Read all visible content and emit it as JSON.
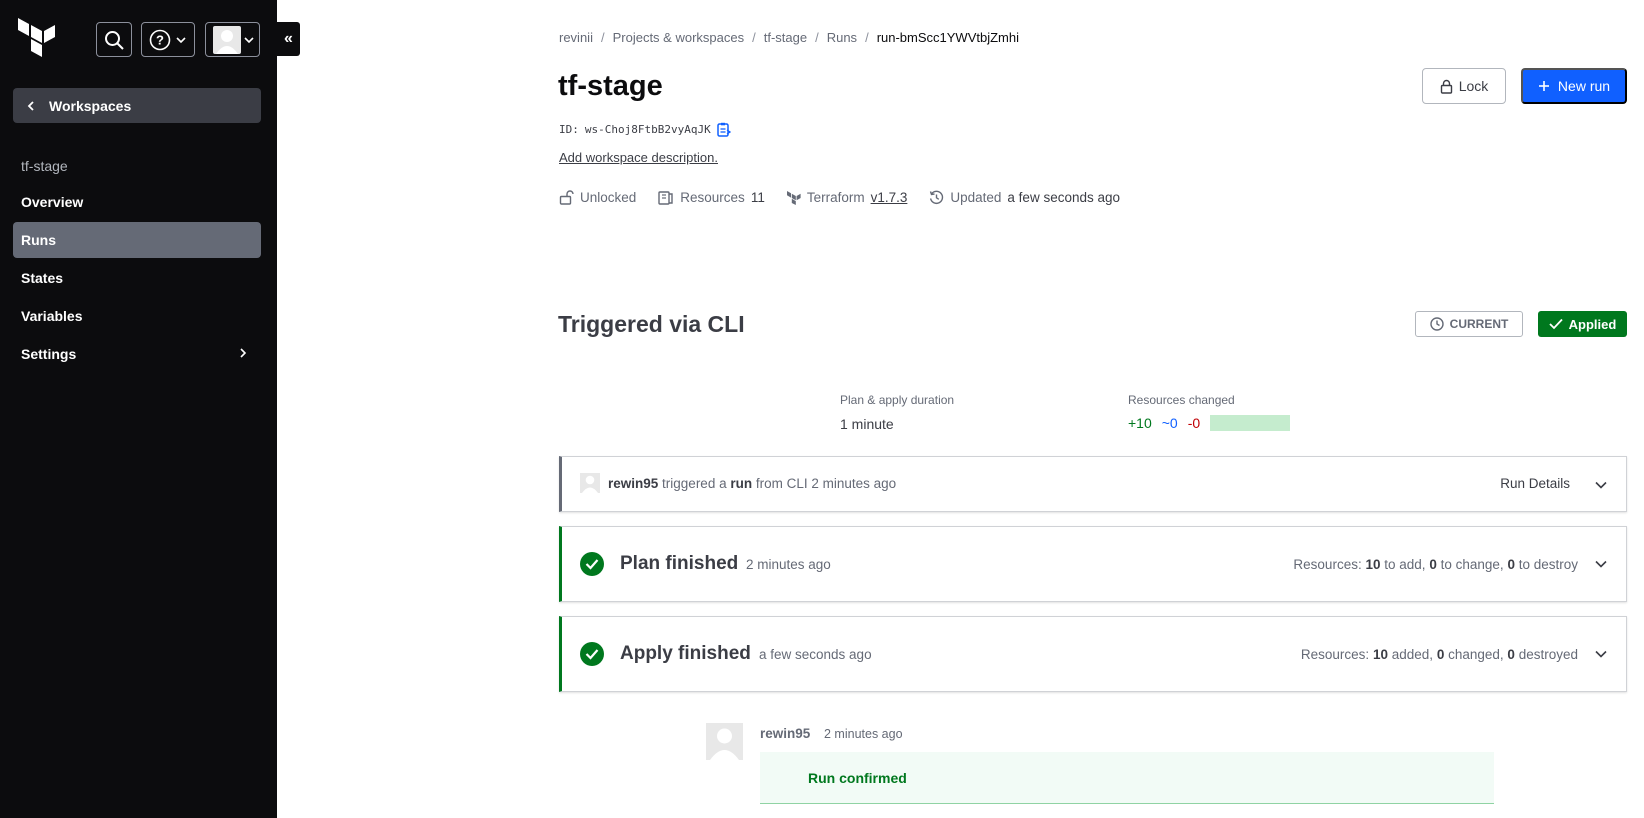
{
  "nav": {
    "workspaces_label": "Workspaces",
    "workspace_name": "tf-stage",
    "items": [
      {
        "label": "Overview"
      },
      {
        "label": "Runs"
      },
      {
        "label": "States"
      },
      {
        "label": "Variables"
      },
      {
        "label": "Settings"
      }
    ],
    "active": "Runs"
  },
  "breadcrumb": [
    "revinii",
    "Projects & workspaces",
    "tf-stage",
    "Runs",
    "run-bmScc1YWVtbjZmhi"
  ],
  "workspace": {
    "title": "tf-stage",
    "id_label": "ID:",
    "id": "ws-Choj8FtbB2vyAqJK",
    "add_description": "Add workspace description.",
    "lock_status": "Unlocked",
    "resources_label": "Resources",
    "resources_count": "11",
    "terraform_label": "Terraform",
    "terraform_version": "v1.7.3",
    "updated_label": "Updated",
    "updated_value": "a few seconds ago"
  },
  "actions": {
    "lock": "Lock",
    "new_run": "New run"
  },
  "run": {
    "title": "Triggered via CLI",
    "current_badge": "CURRENT",
    "status_badge": "Applied",
    "duration_label": "Plan & apply duration",
    "duration_value": "1 minute",
    "resources_changed_label": "Resources changed",
    "add": "+10",
    "change": "~0",
    "destroy": "-0",
    "trigger": {
      "user": "rewin95",
      "text1": "triggered a",
      "run_word": "run",
      "text2": "from CLI 2 minutes ago",
      "details": "Run Details"
    },
    "plan": {
      "title": "Plan finished",
      "time": "2 minutes ago",
      "res_prefix": "Resources:",
      "add": "10",
      "add_text": "to add,",
      "change": "0",
      "change_text": "to change,",
      "destroy": "0",
      "destroy_text": "to destroy"
    },
    "apply": {
      "title": "Apply finished",
      "time": "a few seconds ago",
      "res_prefix": "Resources:",
      "add": "10",
      "add_text": "added,",
      "change": "0",
      "change_text": "changed,",
      "destroy": "0",
      "destroy_text": "destroyed"
    },
    "comment": {
      "user": "rewin95",
      "time": "2 minutes ago",
      "text": "Run confirmed"
    }
  },
  "colors": {
    "sidebar_bg": "#0c0c0e",
    "primary": "#1060ff",
    "success": "#00781e",
    "destroy": "#c00005"
  }
}
